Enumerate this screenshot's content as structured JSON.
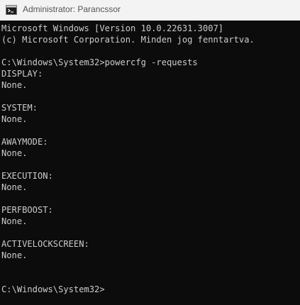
{
  "window": {
    "title": "Administrator: Parancssor",
    "icon": "cmd-icon"
  },
  "console": {
    "lines": [
      "Microsoft Windows [Version 10.0.22631.3007]",
      "(c) Microsoft Corporation. Minden jog fenntartva.",
      "",
      "C:\\Windows\\System32>powercfg -requests",
      "DISPLAY:",
      "None.",
      "",
      "SYSTEM:",
      "None.",
      "",
      "AWAYMODE:",
      "None.",
      "",
      "EXECUTION:",
      "None.",
      "",
      "PERFBOOST:",
      "None.",
      "",
      "ACTIVELOCKSCREEN:",
      "None.",
      "",
      "",
      "C:\\Windows\\System32>"
    ]
  },
  "colors": {
    "console_background": "#0c0c0c",
    "console_text": "#cccccc",
    "titlebar_background": "#f3f3f3",
    "title_text": "#555555"
  }
}
